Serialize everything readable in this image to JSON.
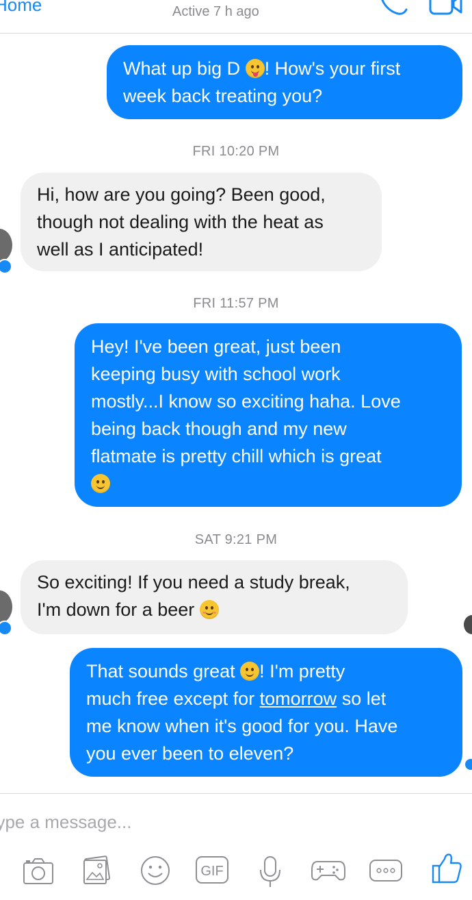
{
  "header": {
    "back_label": "Home",
    "status": "Active 7 h ago"
  },
  "timestamps": {
    "t1": "FRI 10:20 PM",
    "t2": "FRI 11:57 PM",
    "t3": "SAT 9:21 PM"
  },
  "messages": {
    "m1": {
      "sender": "me",
      "line1_a": "What up big D",
      "line1_emoji": "winking-face-with-tongue",
      "line1_b": "!  How's your first",
      "line2": "week back treating you?"
    },
    "m2": {
      "sender": "contact",
      "line1": "Hi, how are you going? Been good,",
      "line2": "though not dealing with the heat as",
      "line3": "well as I anticipated!"
    },
    "m3": {
      "sender": "me",
      "line1": "Hey!  I've been great, just been",
      "line2": "keeping busy with school work",
      "line3": "mostly...I know so exciting haha.  Love",
      "line4": "being back though and my new",
      "line5": "flatmate is pretty chill which is great",
      "line6_emoji": "slightly-smiling-face"
    },
    "m4": {
      "sender": "contact",
      "line1": "So exciting! If you need a study break,",
      "line2_a": "I'm down for a beer",
      "line2_emoji": "smiling-face-with-smiling-eyes"
    },
    "m5": {
      "sender": "me",
      "line1_a": "That sounds great",
      "line1_emoji": "winking-face",
      "line1_b": "!  I'm pretty",
      "line2_a": "much free except for",
      "line2_link": "tomorrow",
      "line2_b": "so let",
      "line3": "me know when it's good for you.  Have",
      "line4": "you ever been to eleven?"
    }
  },
  "composer": {
    "placeholder": "Type a message...",
    "icons": [
      "camera-icon",
      "gallery-icon",
      "emoji-icon",
      "gif-icon",
      "microphone-icon",
      "game-controller-icon",
      "more-icon",
      "thumbs-up-icon"
    ],
    "gif_label": "GIF"
  },
  "colors": {
    "accent": "#0a84ff",
    "incoming_bubble": "#f0f0f0",
    "timestamp": "#8a8a8f"
  }
}
